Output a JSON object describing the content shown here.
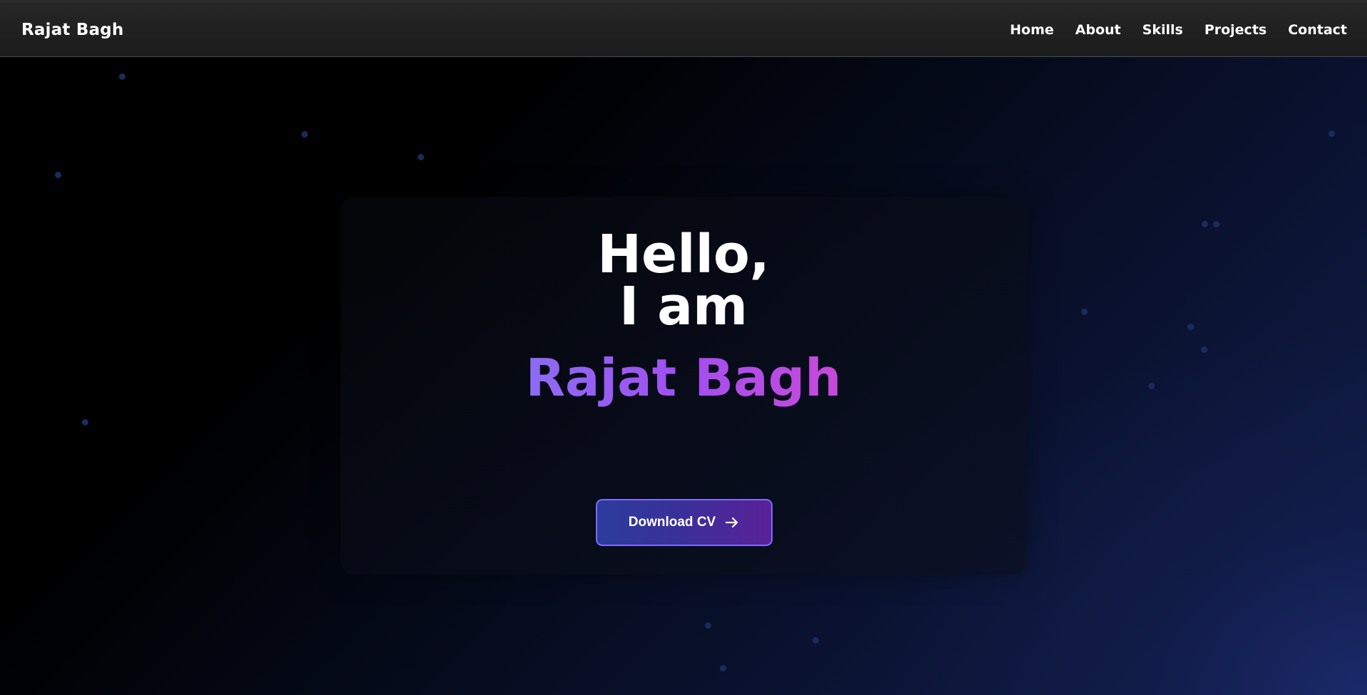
{
  "navbar": {
    "brand": "Rajat Bagh",
    "links": [
      "Home",
      "About",
      "Skills",
      "Projects",
      "Contact"
    ]
  },
  "hero": {
    "line1": "Hello,",
    "line2": "I am",
    "name": "Rajat Bagh",
    "button_label": "Download CV",
    "button_icon": "arrow-right-icon"
  },
  "colors": {
    "background": "#000000",
    "navbar": "#1e1e1f",
    "accent_start": "#8b6cf3",
    "accent_end": "#c84ad8",
    "button_border": "#7f6bff"
  }
}
